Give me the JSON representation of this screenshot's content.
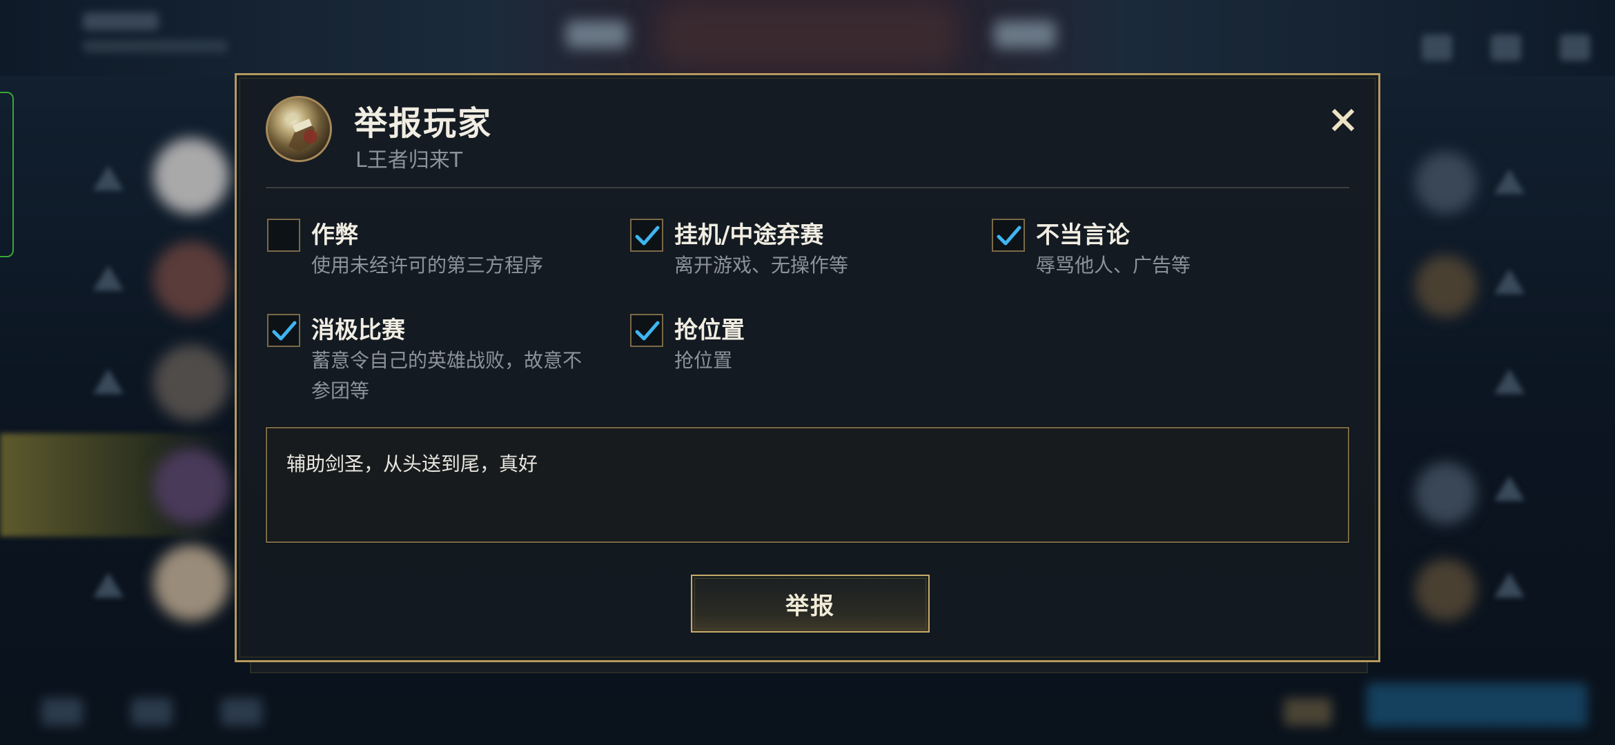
{
  "dialog": {
    "title": "举报玩家",
    "player_name": "L王者归来T",
    "close_icon": "close-icon",
    "options": [
      {
        "label": "作弊",
        "description": "使用未经许可的第三方程序",
        "checked": false
      },
      {
        "label": "挂机/中途弃赛",
        "description": "离开游戏、无操作等",
        "checked": true
      },
      {
        "label": "不当言论",
        "description": "辱骂他人、广告等",
        "checked": true
      },
      {
        "label": "消极比赛",
        "description": "蓄意令自己的英雄战败，故意不参团等",
        "checked": true
      },
      {
        "label": "抢位置",
        "description": "抢位置",
        "checked": true
      }
    ],
    "comment_value": "辅助剑圣，从头送到尾，真好",
    "submit_label": "举报"
  },
  "colors": {
    "accent_gold": "#b79a5e",
    "check_blue": "#3fb6f0",
    "panel_bg": "#141b22",
    "text_primary": "#f1ede2",
    "text_secondary": "#8d939a"
  }
}
